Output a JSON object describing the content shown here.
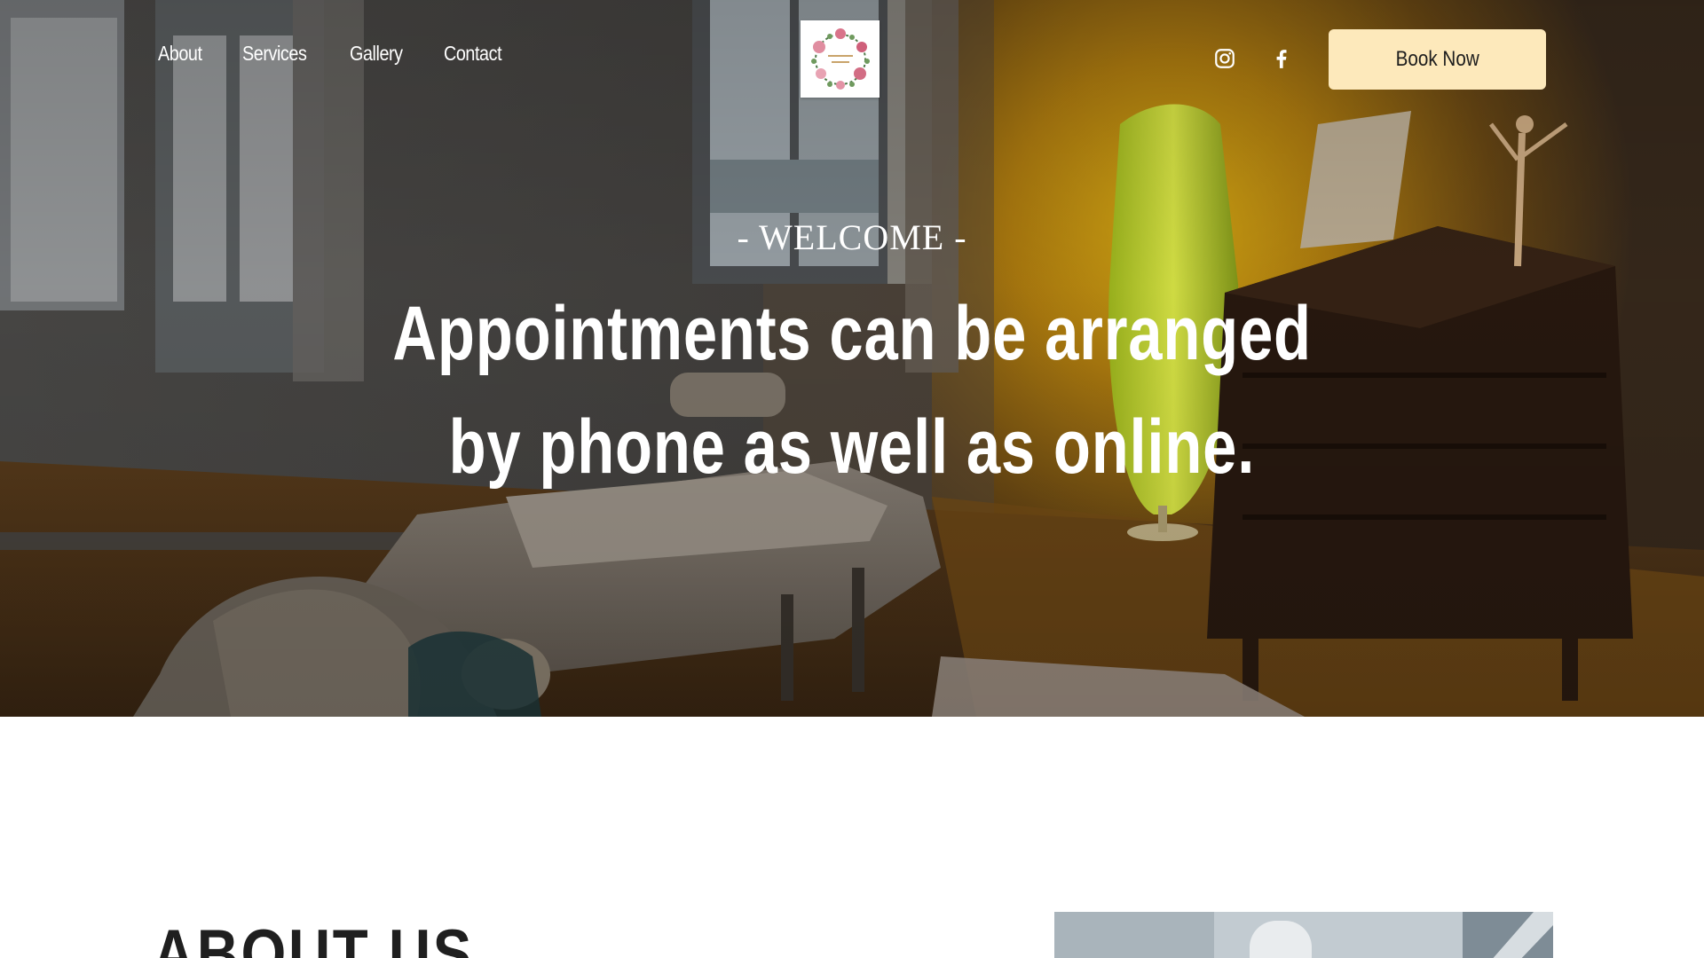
{
  "header": {
    "nav": [
      {
        "label": "About"
      },
      {
        "label": "Services"
      },
      {
        "label": "Gallery"
      },
      {
        "label": "Contact"
      }
    ],
    "logo_icon": "floral-wreath-logo",
    "social": [
      {
        "icon": "instagram-icon"
      },
      {
        "icon": "facebook-icon"
      }
    ],
    "book_button": "Book Now"
  },
  "hero": {
    "kicker": "- WELCOME -",
    "headline_line1": "Appointments can be arranged",
    "headline_line2": "by phone as well as online."
  },
  "about": {
    "title": "ABOUT US"
  },
  "colors": {
    "button_bg": "#fde9bb",
    "button_text": "#1d1d1d",
    "hero_text": "#ffffff"
  }
}
